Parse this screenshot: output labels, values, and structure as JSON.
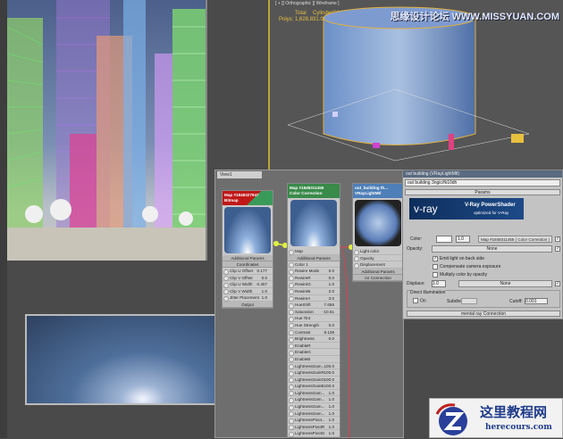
{
  "viewport_ortho": {
    "label": "[ + ][ Orthographic ][ Wireframe ]",
    "stats_total": "Total",
    "stats_object": "CylinderG1",
    "stats_polys": "Polys: 1,628,831.06",
    "watermark": "思缘设计论坛 WWW.MISSYUAN.COM"
  },
  "slate": {
    "tab": "View1",
    "node_bitmap": {
      "title": "Map #1848327947",
      "type": "Bitmap",
      "rows": [
        {
          "label": "Clip U Offset",
          "value": "0.177"
        },
        {
          "label": "Clip V Offset",
          "value": "0.0"
        },
        {
          "label": "Clip U Width",
          "value": "0.407"
        },
        {
          "label": "Clip V Width",
          "value": "1.0"
        },
        {
          "label": "Jitter Placement",
          "value": "1.0"
        }
      ],
      "sec_additional": "Additional Params",
      "sec_coordinates": "Coordinates",
      "sec_output": "Output"
    },
    "node_cc": {
      "title": "Map #1848311455",
      "type": "Color Correction",
      "map": "Map",
      "sec_additional": "Additional Params",
      "rows": [
        {
          "label": "Color 1",
          "value": ""
        },
        {
          "label": "Rewire Mode",
          "value": "0.0"
        },
        {
          "label": "RewireR",
          "value": "0.0"
        },
        {
          "label": "RewireG",
          "value": "1.0"
        },
        {
          "label": "RewireB",
          "value": "2.0"
        },
        {
          "label": "RewireA",
          "value": "3.0"
        },
        {
          "label": "HueShift",
          "value": "7.656"
        },
        {
          "label": "Saturation",
          "value": "-10.61"
        },
        {
          "label": "Hue Tint",
          "value": ""
        },
        {
          "label": "Hue Strength",
          "value": "0.0"
        },
        {
          "label": "Contrast",
          "value": "9.136"
        },
        {
          "label": "Brightness",
          "value": "0.0"
        },
        {
          "label": "EnableR",
          "value": ""
        },
        {
          "label": "EnableG",
          "value": ""
        },
        {
          "label": "EnableB",
          "value": ""
        },
        {
          "label": "LightnessGam...",
          "value": "100.0"
        },
        {
          "label": "LightnessGainR",
          "value": "100.0"
        },
        {
          "label": "LightnessGainG",
          "value": "100.0"
        },
        {
          "label": "LightnessGainB",
          "value": "100.0"
        },
        {
          "label": "LightnessGam...",
          "value": "1.0"
        },
        {
          "label": "LightnessGam...",
          "value": "1.0"
        },
        {
          "label": "LightnessGam...",
          "value": "1.0"
        },
        {
          "label": "LightnessGam...",
          "value": "1.0"
        },
        {
          "label": "LightnessPivot...",
          "value": "1.0"
        },
        {
          "label": "LightnessPivotR",
          "value": "1.0"
        },
        {
          "label": "LightnessPivotG",
          "value": "1.0"
        }
      ]
    },
    "node_mtl": {
      "title": "out_building th...",
      "type": "VRayLightMtl",
      "rows": [
        {
          "label": "Light color"
        },
        {
          "label": "Opacity"
        },
        {
          "label": "Displacement"
        }
      ],
      "sec_additional": "Additional Params",
      "sec_mr": "mr Connection"
    }
  },
  "panel": {
    "title": "out building (VRayLightMtl)",
    "name": "out building 3ngic/fk10dh",
    "rollout": "Params",
    "banner_brand": "v-ray",
    "banner_title": "V-Ray PowerShader",
    "banner_sub": "optimized for V-Ray",
    "color_label": "Color:",
    "color_mult": "1.0",
    "color_map": "Map #1848311455  ( Color Correction )",
    "opacity_label": "Opacity:",
    "opacity_map": "None",
    "check_emit": "Emit light on back side",
    "check_comp": "Compensate camera exposure",
    "check_mult": "Multiply color by opacity",
    "displace_label": "Displace:",
    "displace_val": "1.0",
    "displace_map": "None",
    "direct_label": "Direct illumination",
    "on_label": "On",
    "subdivs_label": "Subdivs:",
    "cutoff_label": "Cutoff:",
    "cutoff_val": "0.001",
    "mr_rollout": "mental ray Connection"
  },
  "logo": {
    "cn": "这里教程网",
    "url": "herecours.com"
  }
}
